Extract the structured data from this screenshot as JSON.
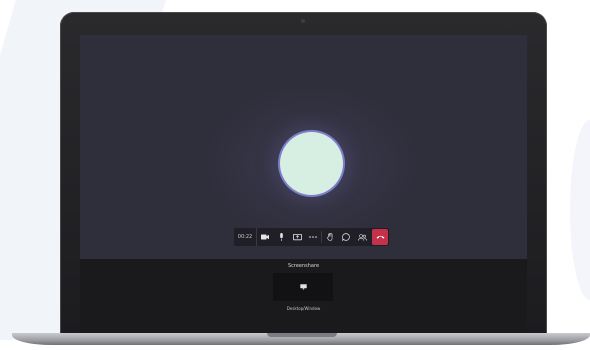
{
  "meeting": {
    "timer": "00:22",
    "avatar_color": "#d7eee3",
    "ring_color": "#7c7fc8"
  },
  "toolbar": {
    "buttons": [
      {
        "icon": "camera-icon"
      },
      {
        "icon": "microphone-icon"
      },
      {
        "icon": "share-screen-icon"
      },
      {
        "icon": "more-options-icon"
      },
      {
        "icon": "raise-hand-icon"
      },
      {
        "icon": "chat-icon"
      },
      {
        "icon": "participants-icon"
      },
      {
        "icon": "hang-up-icon"
      }
    ],
    "hangup_color": "#c4314b"
  },
  "share_panel": {
    "title": "Screenshare",
    "tile_icon": "desktop-window-icon",
    "tile_label": "Desktop/Window"
  },
  "colors": {
    "screen_bg": "#2f2e3b",
    "panel_bg": "#1a1a1c"
  }
}
